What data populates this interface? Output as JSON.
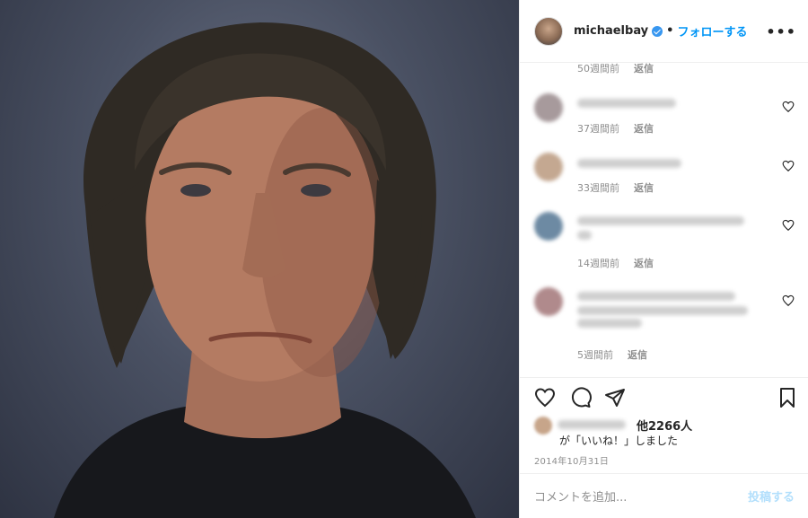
{
  "post": {
    "username": "michaelbay",
    "separator": "•",
    "follow_label": "フォローする",
    "more_label": "•••",
    "photo_alt": "portrait photo"
  },
  "comments": [
    {
      "time": "50週間前",
      "reply": "返信",
      "avatar_color": "#b8b8b8"
    },
    {
      "time": "37週間前",
      "reply": "返信",
      "avatar_color": "#a79a9c"
    },
    {
      "time": "33週間前",
      "reply": "返信",
      "avatar_color": "#c4a891"
    },
    {
      "time": "14週間前",
      "reply": "返信",
      "avatar_color": "#6d8aa3"
    },
    {
      "time": "5週間前",
      "reply": "返信",
      "avatar_color": "#b08a8c"
    }
  ],
  "likes": {
    "count_text": "他2266人",
    "liked_text": "が「いいね！」しました"
  },
  "date": "2014年10月31日",
  "comment_box": {
    "placeholder": "コメントを追加...",
    "post_label": "投稿する"
  },
  "colors": {
    "accent": "#0095f6",
    "muted": "#8e8e8e",
    "border": "#efefef"
  }
}
